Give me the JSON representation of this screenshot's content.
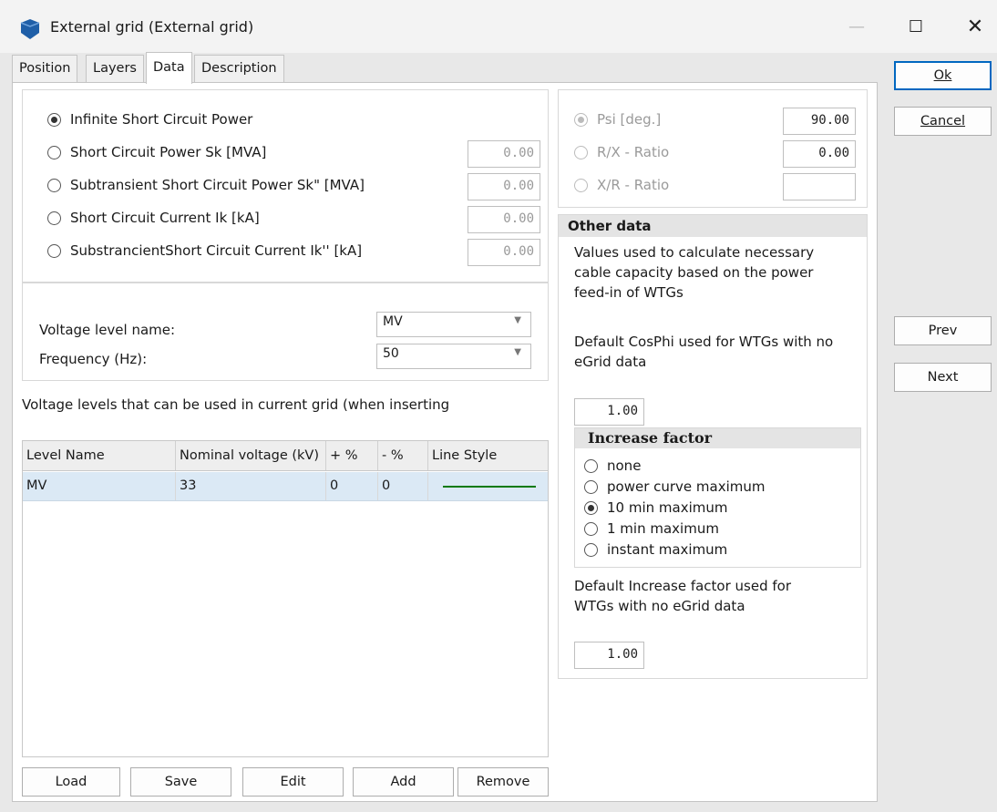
{
  "window": {
    "title": "External grid   (External grid)",
    "min_glyph": "—",
    "max_glyph": "☐",
    "close_glyph": "✕"
  },
  "tabs": [
    {
      "label": "Position"
    },
    {
      "label": "Layers"
    },
    {
      "label": "Data",
      "active": true
    },
    {
      "label": "Description"
    }
  ],
  "short_circuit": {
    "options": [
      {
        "label": "Infinite Short Circuit Power",
        "checked": true
      },
      {
        "label": "Short Circuit Power Sk [MVA]",
        "value": "0.00"
      },
      {
        "label": "Subtransient Short Circuit Power Sk\" [MVA]",
        "value": "0.00"
      },
      {
        "label": "Short Circuit Current Ik [kA]",
        "value": "0.00"
      },
      {
        "label": "SubstrancientShort Circuit Current Ik'' [kA]",
        "value": "0.00"
      }
    ]
  },
  "voltage": {
    "level_label": "Voltage level name:",
    "level_value": "MV",
    "freq_label": "Frequency (Hz):",
    "freq_value": "50",
    "arrow": "▼"
  },
  "levels_caption": "Voltage levels that can be used in current grid (when inserting",
  "levels_table": {
    "columns": [
      "Level Name",
      "Nominal voltage (kV)",
      "+ %",
      "- %",
      "Line Style"
    ],
    "rows": [
      {
        "name": "MV",
        "nominal": "33",
        "plus": "0",
        "minus": "0",
        "line_color": "#0a7a0a"
      }
    ]
  },
  "table_buttons": {
    "load": "Load",
    "save": "Save",
    "edit": "Edit",
    "add": "Add",
    "remove": "Remove"
  },
  "angle": {
    "psi_label": "Psi [deg.]",
    "psi_value": "90.00",
    "rx_label": "R/X - Ratio",
    "rx_value": "0.00",
    "xr_label": "X/R - Ratio",
    "xr_value": ""
  },
  "other_data": {
    "title": "Other data",
    "description": "Values used to calculate necessary cable capacity based on the power feed-in of WTGs",
    "cosphi_label": "Default CosPhi used for WTGs with no eGrid data",
    "cosphi_value": "1.00",
    "increase_title": "Increase factor",
    "increase_options": [
      {
        "label": "none"
      },
      {
        "label": "power curve maximum"
      },
      {
        "label": "10 min maximum",
        "checked": true
      },
      {
        "label": "1 min maximum"
      },
      {
        "label": "instant maximum"
      }
    ],
    "increase_default_label": "Default Increase factor used for WTGs with no eGrid data",
    "increase_default_value": "1.00"
  },
  "side_buttons": {
    "ok": "Ok",
    "cancel": "Cancel",
    "prev": "Prev",
    "next": "Next"
  },
  "colors": {
    "accent": "#0067c0",
    "row_selected": "#dbe9f5",
    "line_style": "#0a7a0a",
    "app_icon": "#1f5fa8"
  }
}
